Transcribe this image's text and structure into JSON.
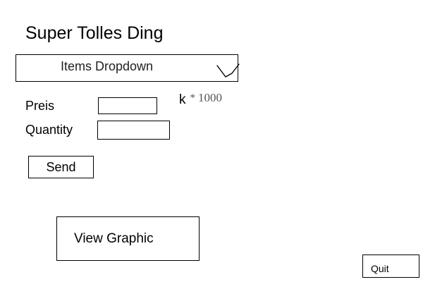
{
  "header": {
    "title": "Super Tolles Ding"
  },
  "dropdown": {
    "label": "Items Dropdown",
    "icon": "checkmark-icon"
  },
  "form": {
    "price_label": "Preis",
    "price_value": "",
    "quantity_label": "Quantity",
    "quantity_value": "",
    "multiplier": {
      "unit": "k",
      "operator": "*",
      "factor": "1000"
    }
  },
  "actions": {
    "send_label": "Send",
    "view_graphic_label": "View Graphic",
    "quit_label": "Quit"
  }
}
